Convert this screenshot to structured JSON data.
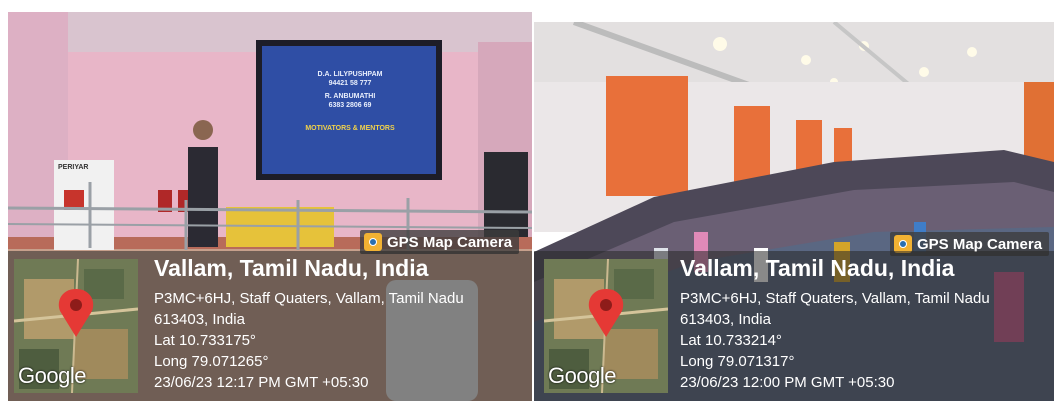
{
  "left": {
    "slide": {
      "line1": "D.A. LILYPUSHPAM",
      "line2": "94421 58 777",
      "line3": "R. ANBUMATHI",
      "line4": "6383 2806 69",
      "line5": "MOTIVATORS & MENTORS"
    },
    "podium_text": "PERIYAR",
    "badge": "GPS Map Camera",
    "google": "Google",
    "city": "Vallam, Tamil Nadu, India",
    "address1": "P3MC+6HJ, Staff Quaters, Vallam, Tamil Nadu",
    "address2": "613403, India",
    "lat": "Lat 10.733175°",
    "long": "Long 79.071265°",
    "datetime": "23/06/23 12:17 PM GMT +05:30"
  },
  "right": {
    "badge": "GPS Map Camera",
    "google": "Google",
    "city": "Vallam, Tamil Nadu, India",
    "address1": "P3MC+6HJ, Staff Quaters, Vallam, Tamil Nadu",
    "address2": "613403, India",
    "lat": "Lat 10.733214°",
    "long": "Long 79.071317°",
    "datetime": "23/06/23 12:00 PM GMT +05:30"
  },
  "colors": {
    "wall_pink": "#e9b3c6",
    "curtain": "#e8703a",
    "screen_blue": "#2e4a9e",
    "map_pin": "#e53935"
  }
}
